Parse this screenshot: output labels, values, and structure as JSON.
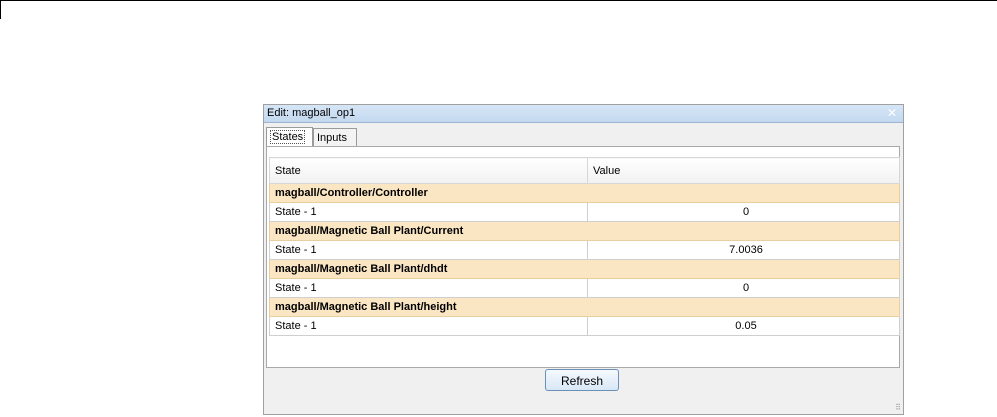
{
  "dialog": {
    "title": "Edit: magball_op1",
    "close_glyph": "✕"
  },
  "tabs": [
    {
      "label": "States",
      "active": true
    },
    {
      "label": "Inputs",
      "active": false
    }
  ],
  "table": {
    "headers": [
      "State",
      "Value"
    ],
    "groups": [
      {
        "name": "magball/Controller/Controller",
        "state": "State - 1",
        "value": "0"
      },
      {
        "name": "magball/Magnetic Ball Plant/Current",
        "state": "State - 1",
        "value": "7.0036"
      },
      {
        "name": "magball/Magnetic Ball Plant/dhdt",
        "state": "State - 1",
        "value": "0"
      },
      {
        "name": "magball/Magnetic Ball Plant/height",
        "state": "State - 1",
        "value": "0.05"
      }
    ]
  },
  "refresh_label": "Refresh",
  "resize_grip_glyph": "⠿",
  "colors": {
    "group_row": "#fbe6c4",
    "titlebar": "#c3d8ef"
  }
}
